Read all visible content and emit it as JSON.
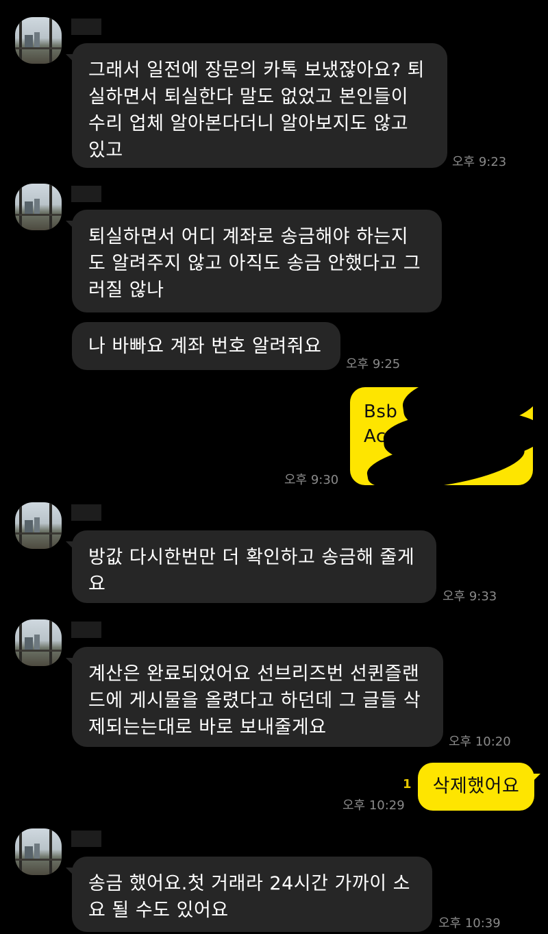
{
  "messages": [
    {
      "text": "그래서 일전에 장문의 카톡 보냈잖아요? 퇴\n실하면서 퇴실한다 말도 없었고 본인들이\n수리 업체 알아본다더니 알아보지도 않고\n있고",
      "time": "오후 9:23"
    },
    {
      "text": "퇴실하면서 어디 계좌로 송금해야 하는지\n도 알려주지 않고 아직도 송금 안했다고 그\n러질 않나"
    },
    {
      "text": "나 바빠요 계좌 번호 알려줘요",
      "time": "오후 9:25"
    },
    {
      "text": "Bsb\nAcc",
      "time": "오후 9:30"
    },
    {
      "text": "방값 다시한번만 더 확인하고 송금해 줄게\n요",
      "time": "오후 9:33"
    },
    {
      "text": "계산은 완료되었어요 선브리즈번 선퀸즐랜\n드에 게시물을 올렸다고 하던데 그 글들 삭\n제되는는대로 바로 보내줄게요",
      "time": "오후 10:20"
    },
    {
      "text": "삭제했어요",
      "time": "오후 10:29",
      "unread": "1"
    },
    {
      "text": "송금 했어요.첫 거래라 24시간 가까이 소\n요 될 수도 있어요",
      "time": "오후 10:39"
    }
  ]
}
